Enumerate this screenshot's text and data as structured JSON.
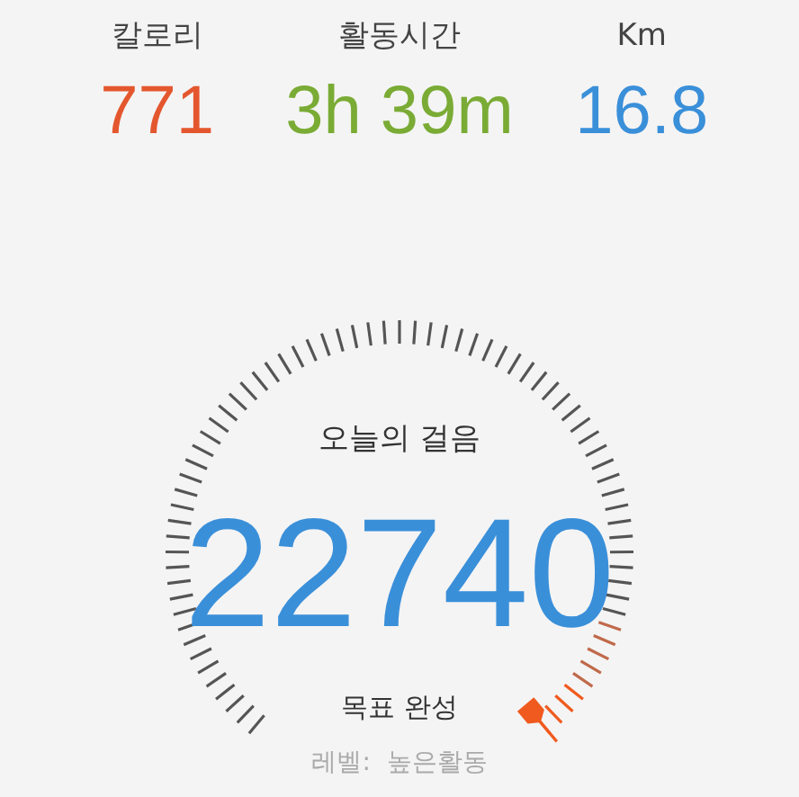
{
  "stats": [
    {
      "label": "칼로리",
      "value": "771",
      "color": "#e4572e"
    },
    {
      "label": "활동시간",
      "value": "3h 39m",
      "color": "#7aab35"
    },
    {
      "label": "Km",
      "value": "16.8",
      "color": "#3a8fd9"
    }
  ],
  "gauge": {
    "title": "오늘의 걸음",
    "steps": "22740",
    "status": "목표 완성",
    "level_text": "레벨:  높은활동"
  }
}
